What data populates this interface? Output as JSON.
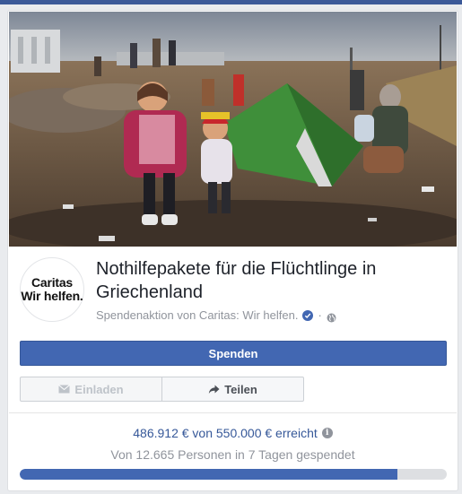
{
  "fundraiser": {
    "title": "Nothilfepakete für die Flüchtlinge in Griechenland",
    "organizer_text": "Spendenaktion von Caritas: Wir helfen.",
    "separator": "·",
    "logo_lines": [
      "Caritas",
      "Wir helfen."
    ]
  },
  "icons": {
    "verified": "verified-badge-icon",
    "audience": "globe-icon",
    "invite": "envelope-icon",
    "share": "share-arrow-icon",
    "info": "info-icon"
  },
  "actions": {
    "donate_label": "Spenden",
    "invite_label": "Einladen",
    "share_label": "Teilen"
  },
  "progress": {
    "raised_text": "486.912 € von 550.000 € erreicht",
    "info_glyph": "i",
    "donors_text": "Von 12.665 Personen in 7 Tagen gespendet",
    "raised_fraction": 0.885
  },
  "colors": {
    "brand": "#4267b2",
    "link": "#365899",
    "muted": "#90949c",
    "topbar": "#3b5998"
  }
}
